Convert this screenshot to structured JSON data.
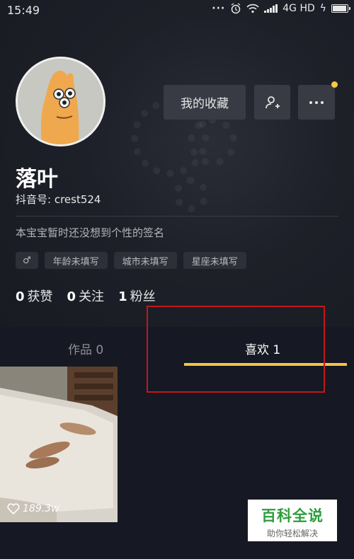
{
  "status_bar": {
    "time": "15:49",
    "network": "4G HD",
    "battery_level": 0.85
  },
  "profile": {
    "nickname": "落叶",
    "douyin_id": "抖音号: crest524",
    "signature": "本宝宝暂时还没想到个性的签名",
    "gender_icon": "♂",
    "tags": [
      "年龄未填写",
      "城市未填写",
      "星座未填写"
    ]
  },
  "actions": {
    "favorites_label": "我的收藏",
    "add_friend_icon": "add-friend-icon",
    "more_icon": "more-icon"
  },
  "stats": [
    {
      "num": "0",
      "label": "获赞"
    },
    {
      "num": "0",
      "label": "关注"
    },
    {
      "num": "1",
      "label": "粉丝"
    }
  ],
  "tabs": {
    "works": "作品 0",
    "likes": "喜欢 1"
  },
  "video": {
    "like_count": "189.3w"
  },
  "watermark": {
    "title": "百科全说",
    "subtitle": "助你轻松解决"
  },
  "colors": {
    "background": "#161823",
    "accent": "#f5c445",
    "highlight": "#c4161c"
  }
}
